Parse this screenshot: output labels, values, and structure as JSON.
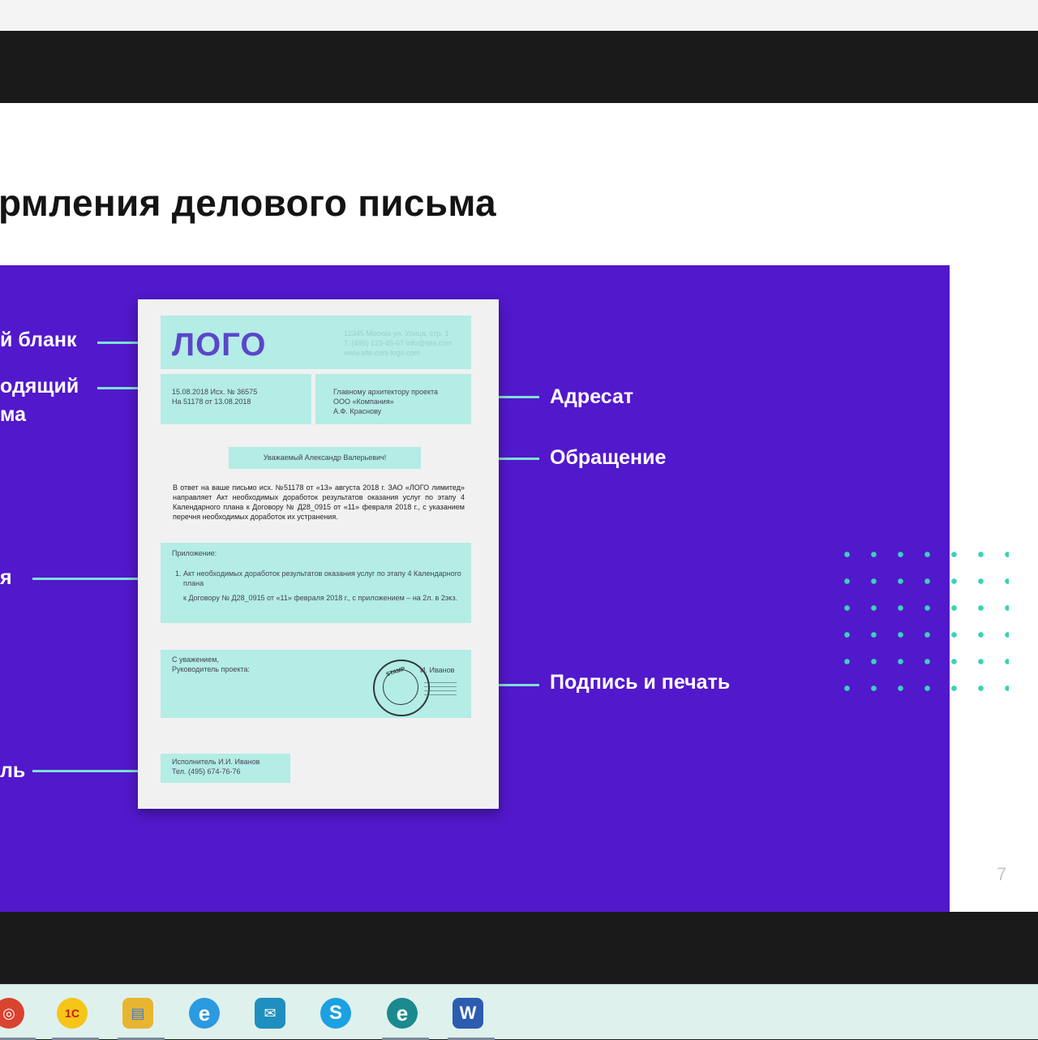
{
  "slide": {
    "title": "рмления делового письма",
    "page_number": "7"
  },
  "labels_left": {
    "blank": "й бланк",
    "outgoing_line1": "одящий",
    "outgoing_line2": "ма",
    "attachment": "я",
    "executor": "ль"
  },
  "labels_right": {
    "addressee": "Адресат",
    "salutation": "Обращение",
    "signature": "Подпись и печать"
  },
  "letter": {
    "logo": "ЛОГО",
    "header_address": [
      "12345 Москва ул. Улица, стр. 1",
      "Т. (495) 123-45-67 info@site.com",
      "www.site.com  logo.com"
    ],
    "ref_lines": [
      "15.08.2018 Исх. № 36575",
      "На 51178 от 13.08.2018"
    ],
    "addressee_lines": [
      "Главному архитектору проекта",
      "ООО «Компания»",
      "А.Ф. Краснову"
    ],
    "salutation": "Уважаемый Александр Валерьевич!",
    "body": "В ответ на ваше письмо исх. №51178 от «13» августа 2018 г. ЗАО «ЛОГО лимитед» направляет Акт необходимых доработок результатов оказания услуг по этапу 4 Календарного плана к Договору № Д28_0915 от «11» февраля 2018 г., с указанием перечня необходимых доработок их устранения.",
    "attachment_title": "Приложение:",
    "attachment_items": [
      "Акт необходимых доработок результатов оказания услуг по этапу 4 Календарного плана",
      "к Договору № Д28_0915 от «11» февраля 2018 г., с приложением – на 2л. в 2экз."
    ],
    "sign_lines": [
      "С уважением,",
      "Руководитель проекта:"
    ],
    "sign_name": "И. Иванов",
    "stamp_text": "STAMP",
    "executor_lines": [
      "Исполнитель И.И. Иванов",
      "Тел. (495) 674-76-76"
    ]
  },
  "taskbar": {
    "apps": [
      {
        "name": "Chrome",
        "icon": "chrome-icon",
        "glyph": "◎",
        "color": "#d9432f"
      },
      {
        "name": "1С",
        "icon": "1c-icon",
        "glyph": "1С",
        "color": "#f5c518"
      },
      {
        "name": "Проводник",
        "icon": "folder-icon",
        "glyph": "▤",
        "color": "#e8b531"
      },
      {
        "name": "Internet Explorer",
        "icon": "internet-explorer-icon",
        "glyph": "e",
        "color": "#2b9ae0"
      },
      {
        "name": "Сообщения",
        "icon": "messages-icon",
        "glyph": "✉",
        "color": "#1f8fbf"
      },
      {
        "name": "Skype",
        "icon": "skype-icon",
        "glyph": "S",
        "color": "#1ba1e2"
      },
      {
        "name": "Edge",
        "icon": "edge-icon",
        "glyph": "e",
        "color": "#1a8a8f"
      },
      {
        "name": "Word",
        "icon": "word-icon",
        "glyph": "W",
        "color": "#2b5cb0"
      }
    ]
  }
}
